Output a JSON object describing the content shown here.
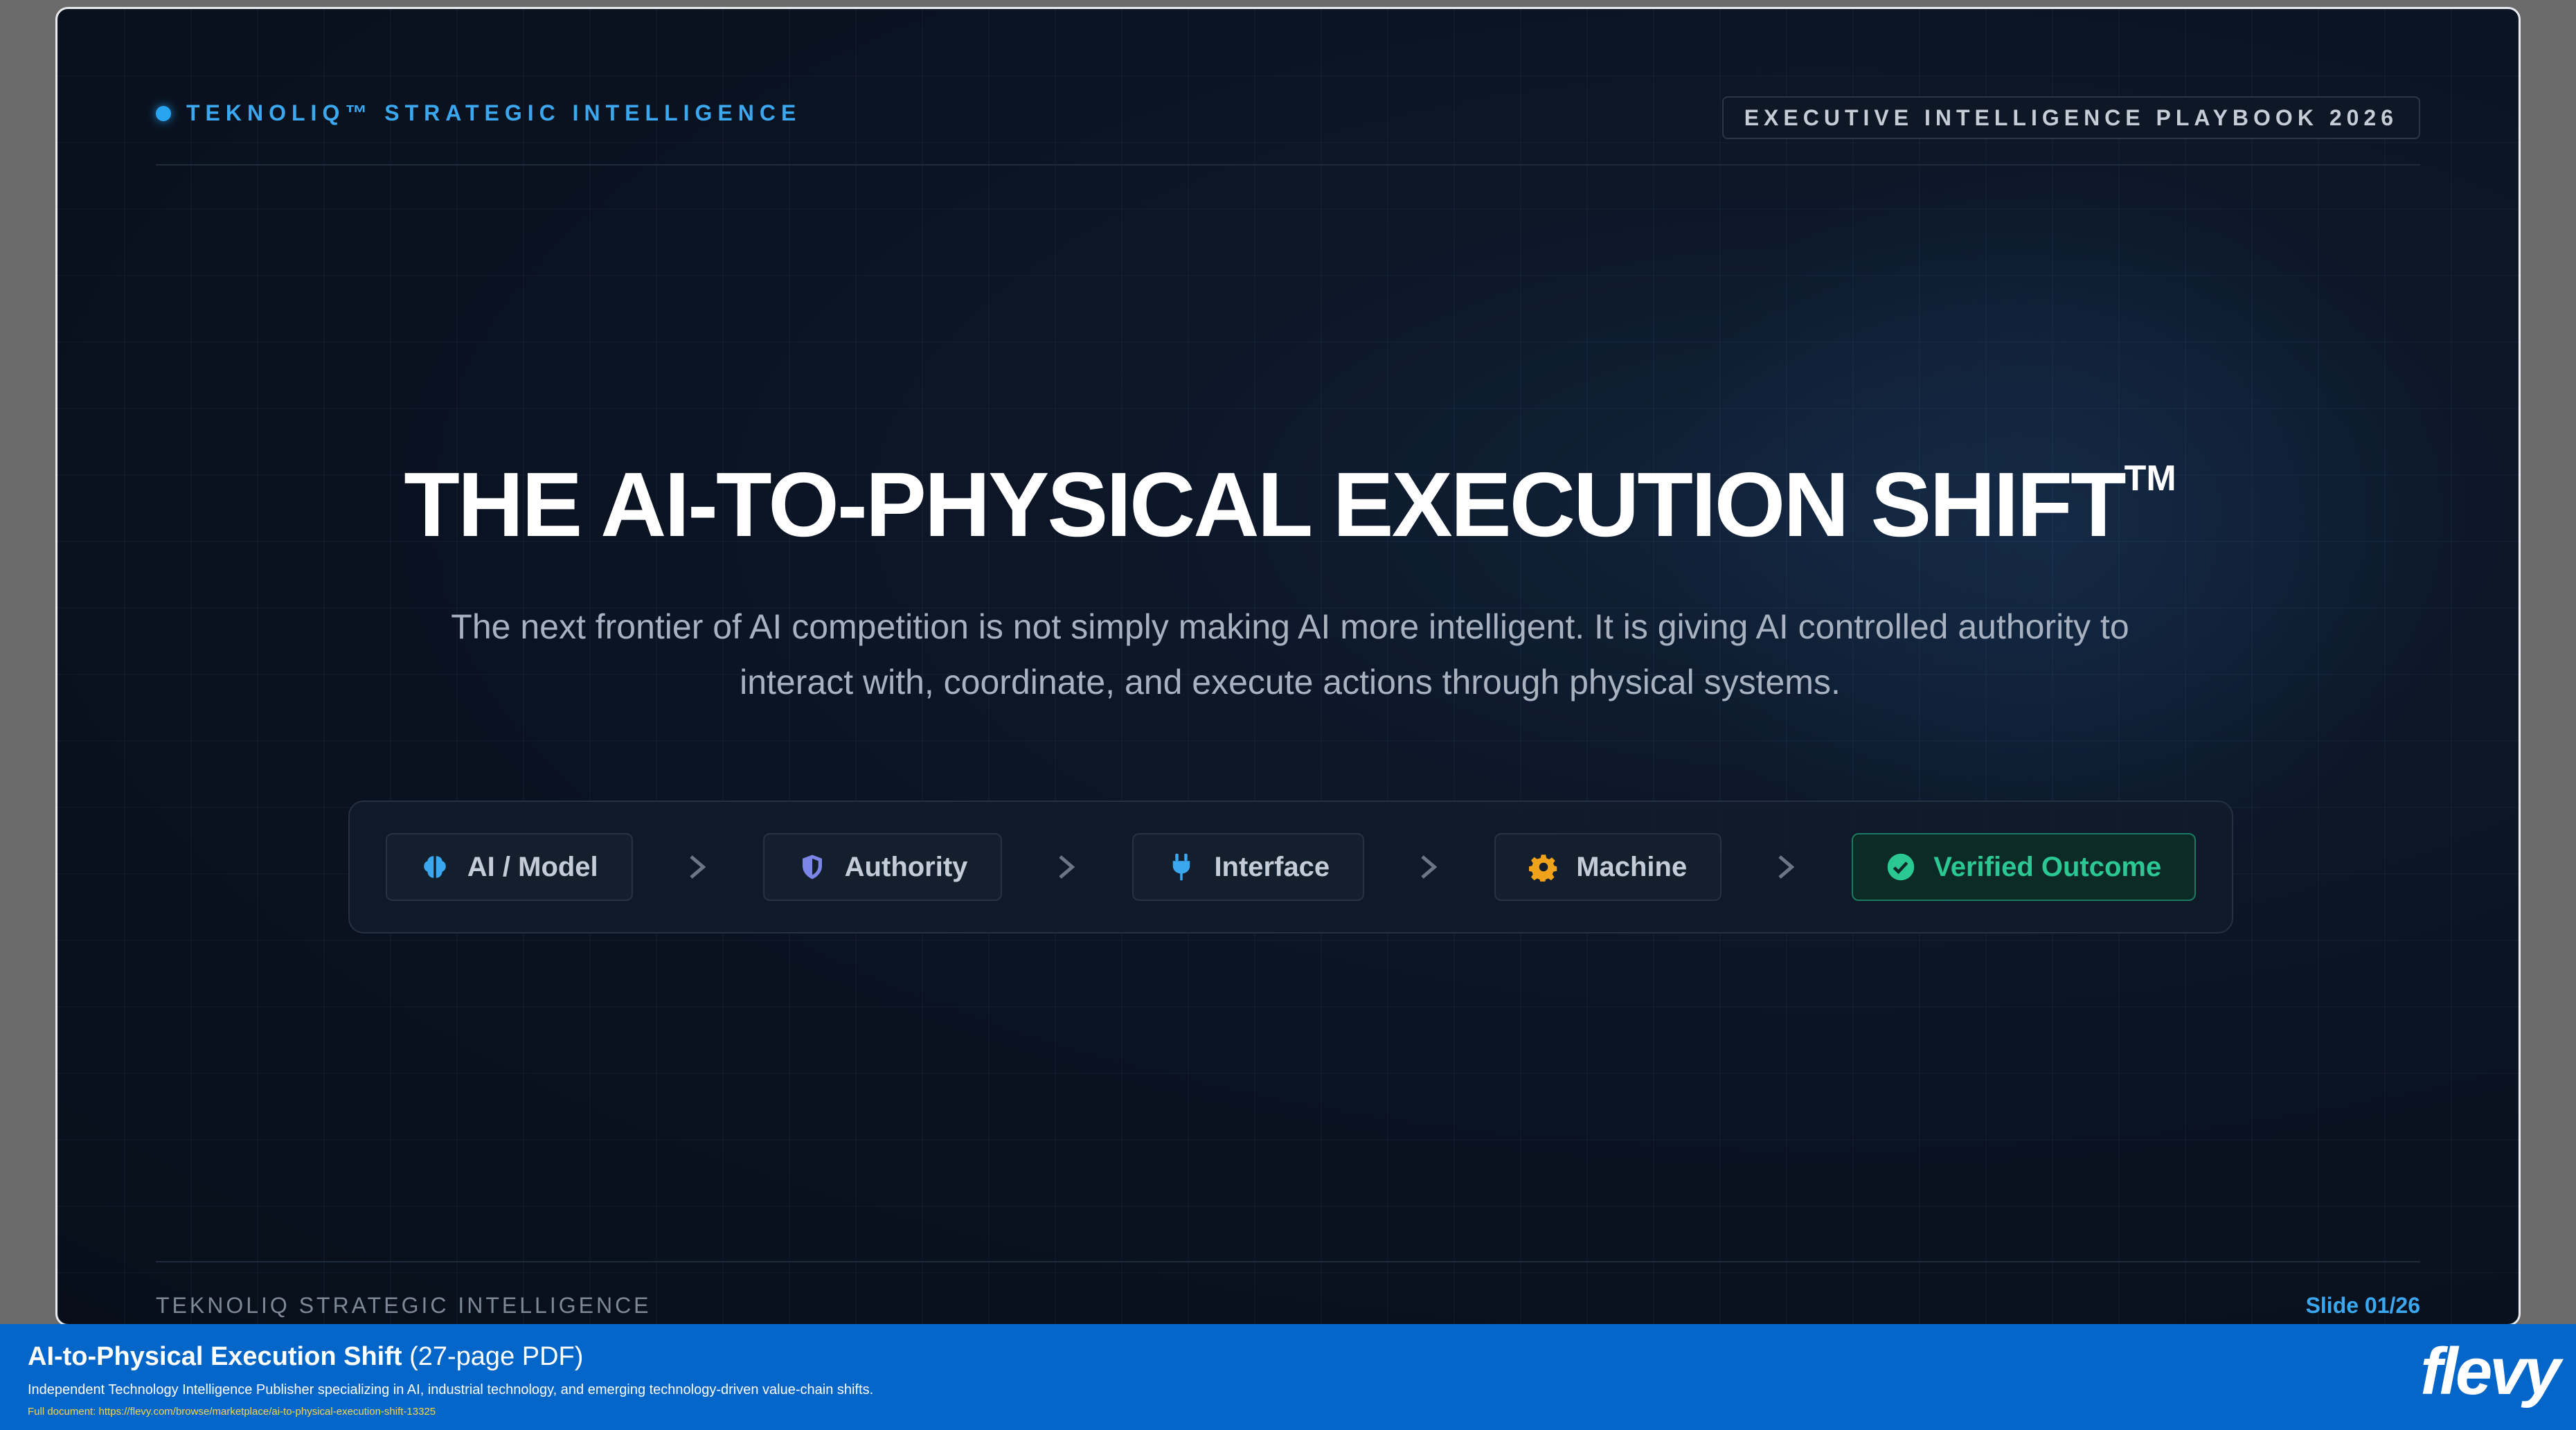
{
  "slide": {
    "brand": "TEKNOLIQ™ STRATEGIC INTELLIGENCE",
    "tag": "EXECUTIVE INTELLIGENCE PLAYBOOK 2026",
    "title": "THE AI-TO-PHYSICAL EXECUTION SHIFT",
    "title_mark": "TM",
    "subtitle": "The next frontier of AI competition is not simply making AI more intelligent. It is giving AI controlled authority to interact with, coordinate, and execute actions through physical systems.",
    "flow": [
      {
        "label": "AI / Model",
        "icon": "brain-icon",
        "color": "#3aa7ef"
      },
      {
        "label": "Authority",
        "icon": "shield-icon",
        "color": "#7b86e8"
      },
      {
        "label": "Interface",
        "icon": "plug-icon",
        "color": "#3aa7ef"
      },
      {
        "label": "Machine",
        "icon": "gear-icon",
        "color": "#f0a21a"
      },
      {
        "label": "Verified Outcome",
        "icon": "check-circle-icon",
        "color": "#2bc894"
      }
    ],
    "footer_left": "TEKNOLIQ STRATEGIC INTELLIGENCE",
    "footer_right": "Slide 01/26"
  },
  "banner": {
    "title": "AI-to-Physical Execution Shift",
    "title_suffix": " (27-page PDF)",
    "description": "Independent Technology Intelligence Publisher specializing in AI, industrial technology, and emerging technology-driven value-chain shifts.",
    "url": "Full document: https://flevy.com/browse/marketplace/ai-to-physical-execution-shift-13325",
    "logo": "flevy"
  }
}
